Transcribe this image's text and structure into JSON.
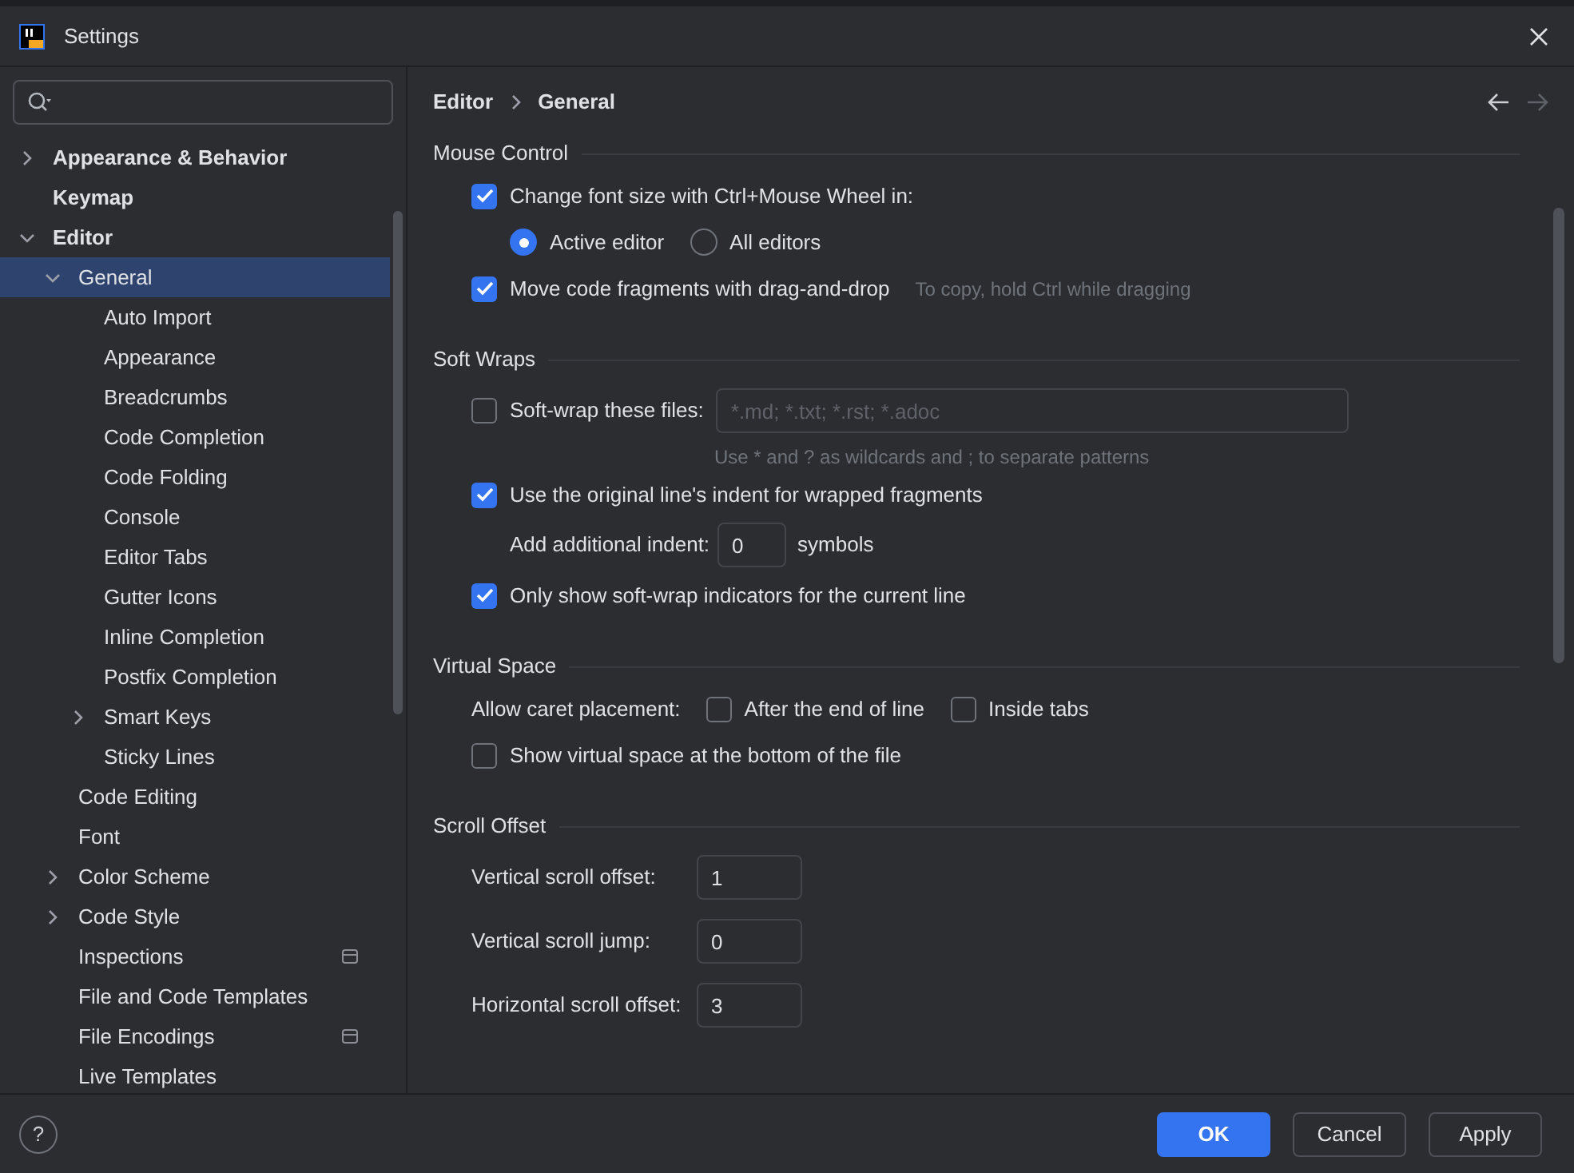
{
  "window": {
    "title": "Settings"
  },
  "help": {
    "label": "?"
  },
  "tree": [
    {
      "label": "Appearance & Behavior",
      "kind": "folder",
      "expanded": false,
      "selected": false
    },
    {
      "label": "Keymap",
      "kind": "page",
      "selected": false
    },
    {
      "label": "Editor",
      "kind": "folder",
      "expanded": true,
      "selected": false,
      "children": [
        {
          "label": "General",
          "kind": "folder",
          "expanded": true,
          "selected": true,
          "children": [
            {
              "label": "Auto Import",
              "kind": "page",
              "selected": false
            },
            {
              "label": "Appearance",
              "kind": "page",
              "selected": false
            },
            {
              "label": "Breadcrumbs",
              "kind": "page",
              "selected": false
            },
            {
              "label": "Code Completion",
              "kind": "page",
              "selected": false
            },
            {
              "label": "Code Folding",
              "kind": "page",
              "selected": false
            },
            {
              "label": "Console",
              "kind": "page",
              "selected": false
            },
            {
              "label": "Editor Tabs",
              "kind": "page",
              "selected": false
            },
            {
              "label": "Gutter Icons",
              "kind": "page",
              "selected": false
            },
            {
              "label": "Inline Completion",
              "kind": "page",
              "selected": false
            },
            {
              "label": "Postfix Completion",
              "kind": "page",
              "selected": false
            },
            {
              "label": "Smart Keys",
              "kind": "folder",
              "expanded": false,
              "selected": false
            },
            {
              "label": "Sticky Lines",
              "kind": "page",
              "selected": false
            }
          ]
        },
        {
          "label": "Code Editing",
          "kind": "page",
          "selected": false
        },
        {
          "label": "Font",
          "kind": "page",
          "selected": false
        },
        {
          "label": "Color Scheme",
          "kind": "folder",
          "expanded": false,
          "selected": false
        },
        {
          "label": "Code Style",
          "kind": "folder",
          "expanded": false,
          "selected": false
        },
        {
          "label": "Inspections",
          "kind": "project_page",
          "selected": false
        },
        {
          "label": "File and Code Templates",
          "kind": "page",
          "selected": false
        },
        {
          "label": "File Encodings",
          "kind": "project_page",
          "selected": false
        },
        {
          "label": "Live Templates",
          "kind": "page",
          "selected": false
        }
      ]
    }
  ],
  "breadcrumb": [
    "Editor",
    "General"
  ],
  "sections": [
    {
      "title": "Mouse Control",
      "rows": [
        {
          "kind": "checkbox",
          "label": "Change font size with Ctrl+Mouse Wheel in:",
          "checked": true
        },
        {
          "kind": "radio_group",
          "options": [
            {
              "label": "Active editor",
              "selected": true
            },
            {
              "label": "All editors",
              "selected": false
            }
          ]
        },
        {
          "kind": "checkbox",
          "label": "Move code fragments with drag-and-drop",
          "checked": true,
          "hint": "To copy, hold Ctrl while dragging"
        }
      ]
    },
    {
      "title": "Soft Wraps",
      "rows": [
        {
          "kind": "checkbox_field",
          "label": "Soft-wrap these files:",
          "checked": false,
          "placeholder": "*.md; *.txt; *.rst; *.adoc",
          "hint": "Use * and ? as wildcards and ; to separate patterns"
        },
        {
          "kind": "checkbox",
          "label": "Use the original line's indent for wrapped fragments",
          "checked": true
        },
        {
          "kind": "number",
          "label": "Add additional indent:",
          "value": "0",
          "suffix": "symbols"
        },
        {
          "kind": "checkbox",
          "label": "Only show soft-wrap indicators for the current line",
          "checked": true
        }
      ]
    },
    {
      "title": "Virtual Space",
      "rows": [
        {
          "kind": "checkbox_group",
          "label": "Allow caret placement:",
          "options": [
            {
              "label": "After the end of line",
              "checked": false
            },
            {
              "label": "Inside tabs",
              "checked": false
            }
          ]
        },
        {
          "kind": "checkbox",
          "label": "Show virtual space at the bottom of the file",
          "checked": false
        }
      ]
    },
    {
      "title": "Scroll Offset",
      "rows": [
        {
          "kind": "labeled_field",
          "label": "Vertical scroll offset:",
          "value": "1"
        },
        {
          "kind": "labeled_field",
          "label": "Vertical scroll jump:",
          "value": "0"
        },
        {
          "kind": "labeled_field",
          "label": "Horizontal scroll offset:",
          "value": "3"
        }
      ]
    }
  ],
  "buttons": [
    {
      "label": "OK",
      "kind": "primary"
    },
    {
      "label": "Cancel",
      "kind": "secondary"
    },
    {
      "label": "Apply",
      "kind": "secondary"
    }
  ]
}
